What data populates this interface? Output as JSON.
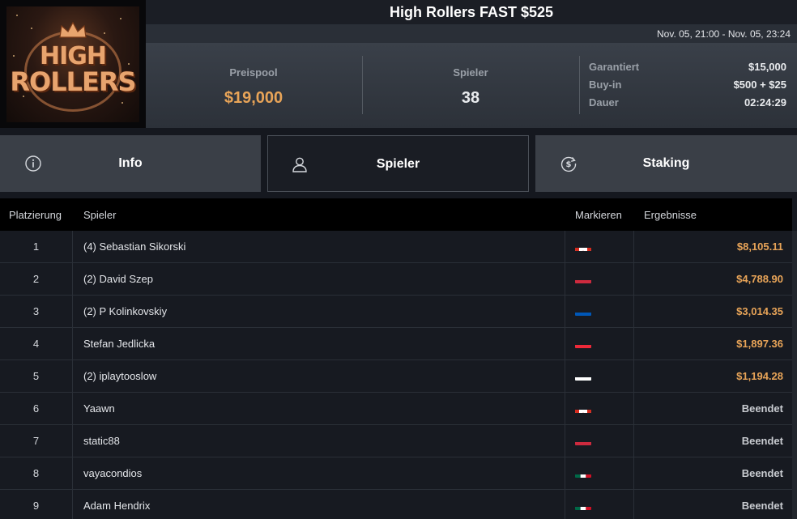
{
  "logo": {
    "line1": "HIGH",
    "line2": "ROLLERS"
  },
  "tournament": {
    "title": "High Rollers FAST $525",
    "date_range": "Nov. 05, 21:00 - Nov. 05, 23:24"
  },
  "stats": {
    "prize_label": "Preispool",
    "prize_value": "$19,000",
    "players_label": "Spieler",
    "players_value": "38",
    "details": [
      {
        "label": "Garantiert",
        "value": "$15,000"
      },
      {
        "label": "Buy-in",
        "value": "$500 + $25"
      },
      {
        "label": "Dauer",
        "value": "02:24:29"
      }
    ]
  },
  "tabs": [
    {
      "label": "Info",
      "icon": "info-icon",
      "active": false
    },
    {
      "label": "Spieler",
      "icon": "user-icon",
      "active": true
    },
    {
      "label": "Staking",
      "icon": "dollar-cycle-icon",
      "active": false
    }
  ],
  "table": {
    "headers": {
      "rank": "Platzierung",
      "player": "Spieler",
      "mark": "Markieren",
      "results": "Ergebnisse"
    },
    "rows": [
      {
        "rank": "1",
        "name": "(4) Sebastian Sikorski",
        "flag": "canada",
        "result": "$8,105.11",
        "paid": true
      },
      {
        "rank": "2",
        "name": "(2) David Szep",
        "flag": "hungary",
        "result": "$4,788.90",
        "paid": true
      },
      {
        "rank": "3",
        "name": "(2) P Kolinkovskiy",
        "flag": "ukraine",
        "result": "$3,014.35",
        "paid": true
      },
      {
        "rank": "4",
        "name": "Stefan Jedlicka",
        "flag": "austria",
        "result": "$1,897.36",
        "paid": true
      },
      {
        "rank": "5",
        "name": "(2) iplaytooslow",
        "flag": "russia",
        "result": "$1,194.28",
        "paid": true
      },
      {
        "rank": "6",
        "name": "Yaawn",
        "flag": "canada",
        "result": "Beendet",
        "paid": false
      },
      {
        "rank": "7",
        "name": "static88",
        "flag": "hungary",
        "result": "Beendet",
        "paid": false
      },
      {
        "rank": "8",
        "name": "vayacondios",
        "flag": "mexico",
        "result": "Beendet",
        "paid": false
      },
      {
        "rank": "9",
        "name": "Adam Hendrix",
        "flag": "mexico",
        "result": "Beendet",
        "paid": false
      }
    ]
  },
  "colors": {
    "accent_gold": "#e8a458",
    "active_tab_bg": "#1a1d24",
    "header_bg": "#000000"
  }
}
